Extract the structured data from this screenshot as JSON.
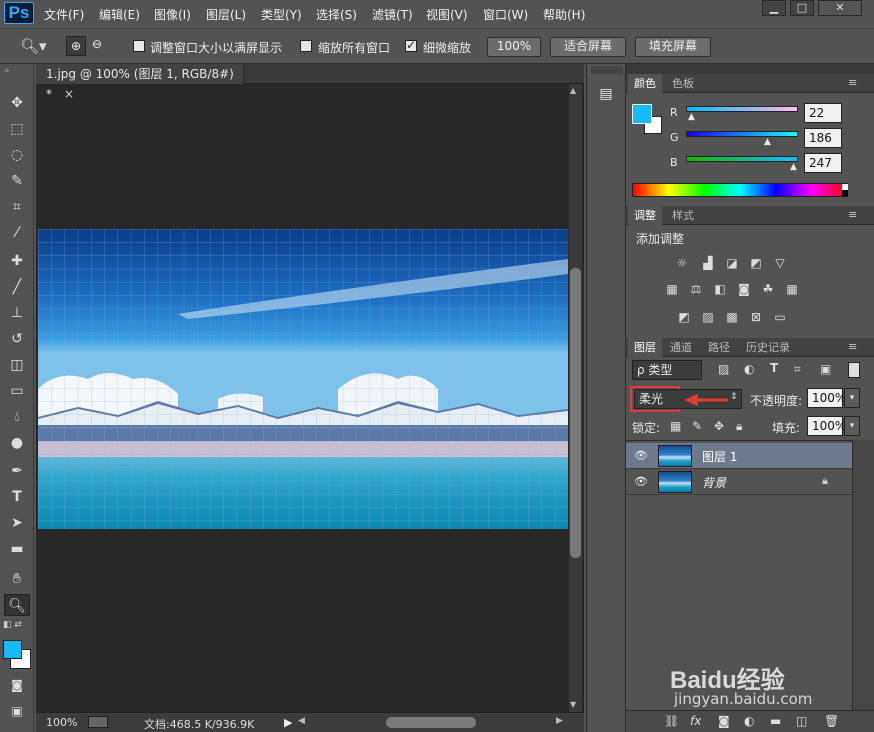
{
  "app": {
    "logo": "Ps"
  },
  "menu": [
    "文件(F)",
    "编辑(E)",
    "图像(I)",
    "图层(L)",
    "类型(Y)",
    "选择(S)",
    "滤镜(T)",
    "视图(V)",
    "窗口(W)",
    "帮助(H)"
  ],
  "window_controls": {
    "minimize": "▁",
    "maximize": "□",
    "close": "✕"
  },
  "options": {
    "resize_windows": "调整窗口大小以满屏显示",
    "zoom_all": "缩放所有窗口",
    "scrubby_zoom": "细微缩放",
    "zoom_value": "100%",
    "fit_screen": "适合屏幕",
    "fill_screen": "填充屏幕"
  },
  "document": {
    "tab_title": "1.jpg @ 100% (图层 1, RGB/8#) *",
    "tab_close": "×",
    "status_zoom": "100%",
    "status_doc": "文档:468.5 K/936.9K"
  },
  "color_panel": {
    "tabs": [
      "颜色",
      "色板"
    ],
    "r_label": "R",
    "g_label": "G",
    "b_label": "B",
    "r": "22",
    "g": "186",
    "b": "247",
    "foreground": "#16baf7",
    "background": "#ffffff"
  },
  "adjust_panel": {
    "tabs": [
      "调整",
      "样式"
    ],
    "title": "添加调整"
  },
  "layers_panel": {
    "tabs": [
      "图层",
      "通道",
      "路径",
      "历史记录"
    ],
    "filter": "ρ 类型",
    "blend_mode": "柔光",
    "opacity_label": "不透明度:",
    "opacity": "100%",
    "lock_label": "锁定:",
    "fill_label": "填充:",
    "fill": "100%",
    "layers": [
      {
        "name": "图层 1",
        "selected": true
      },
      {
        "name": "背景",
        "selected": false,
        "locked": true
      }
    ]
  },
  "watermark": {
    "brand": "Baidu经验",
    "url": "jingyan.baidu.com"
  }
}
